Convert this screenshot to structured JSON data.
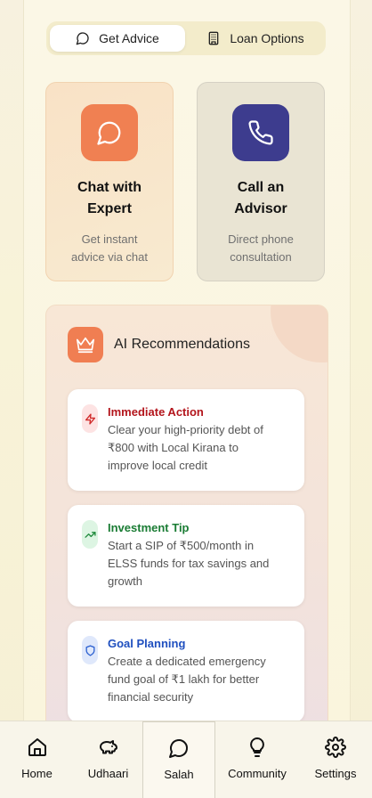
{
  "tabs": [
    {
      "label": "Get Advice",
      "icon": "chat-bubble-icon",
      "active": true
    },
    {
      "label": "Loan Options",
      "icon": "building-icon",
      "active": false
    }
  ],
  "cards": {
    "chat": {
      "title_line1": "Chat with",
      "title_line2": "Expert",
      "desc_line1": "Get instant",
      "desc_line2": "advice via chat",
      "icon": "chat-bubble-icon",
      "color": "#f08052"
    },
    "call": {
      "title_line1": "Call an",
      "title_line2": "Advisor",
      "desc_line1": "Direct phone",
      "desc_line2": "consultation",
      "icon": "phone-icon",
      "color": "#3d3c8e"
    }
  },
  "ai": {
    "heading": "AI Recommendations",
    "icon": "crown-icon",
    "items": [
      {
        "title": "Immediate Action",
        "lines": [
          "Clear your high-priority debt of",
          "₹800 with Local Kirana to",
          "improve local credit"
        ],
        "icon": "lightning-icon",
        "color": "#b3151c"
      },
      {
        "title": "Investment Tip",
        "lines": [
          "Start a SIP of ₹500/month in",
          "ELSS funds for tax savings and",
          "growth"
        ],
        "icon": "trend-up-icon",
        "color": "#1a7c34"
      },
      {
        "title": "Goal Planning",
        "lines": [
          "Create a dedicated emergency",
          "fund goal of ₹1 lakh for better",
          "financial security"
        ],
        "icon": "shield-icon",
        "color": "#1f4fbf"
      }
    ]
  },
  "nav": [
    {
      "label": "Home",
      "icon": "home-icon",
      "active": false
    },
    {
      "label": "Udhaari",
      "icon": "piggy-bank-icon",
      "active": false
    },
    {
      "label": "Salah",
      "icon": "chat-bubble-icon",
      "active": true
    },
    {
      "label": "Community",
      "icon": "lightbulb-icon",
      "active": false
    },
    {
      "label": "Settings",
      "icon": "gear-icon",
      "active": false
    }
  ]
}
